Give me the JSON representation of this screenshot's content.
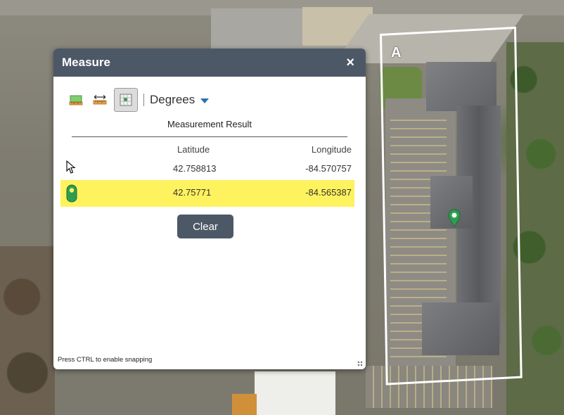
{
  "map": {
    "area_label": "A"
  },
  "panel": {
    "title": "Measure",
    "close_glyph": "×",
    "unit": "Degrees",
    "tools": [
      {
        "name": "area-tool-icon",
        "active": false
      },
      {
        "name": "distance-tool-icon",
        "active": false
      },
      {
        "name": "location-tool-icon",
        "active": true
      }
    ],
    "result_title": "Measurement Result",
    "columns": {
      "latitude": "Latitude",
      "longitude": "Longitude"
    },
    "rows": [
      {
        "latitude": "42.758813",
        "longitude": "-84.570757",
        "icon": "cursor-icon",
        "highlighted": false
      },
      {
        "latitude": "42.75771",
        "longitude": "-84.565387",
        "icon": "map-pin-icon",
        "highlighted": true
      }
    ],
    "clear_label": "Clear",
    "snap_hint": "Press CTRL to enable snapping"
  },
  "colors": {
    "header": "#4d5867",
    "highlight": "#fef25e",
    "pin": "#2e9d4f"
  }
}
